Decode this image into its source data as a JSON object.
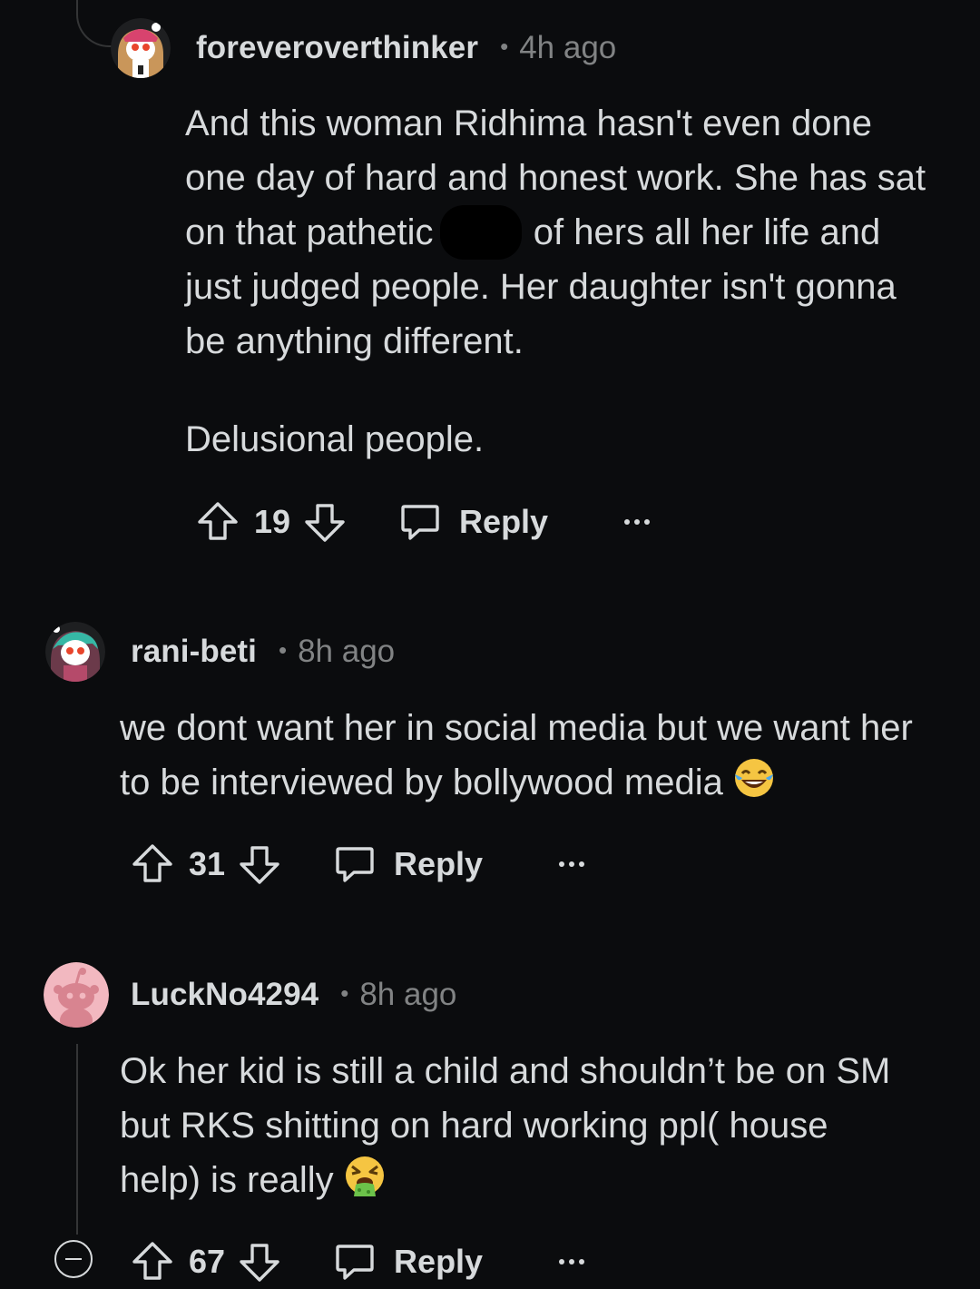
{
  "comments": [
    {
      "username": "foreveroverthinker",
      "separator": "•",
      "time": "4h ago",
      "body_paragraphs": [
        {
          "before": "And this woman Ridhima hasn't even done one day of hard and honest work. She has sat on that pathetic",
          "after": "of hers all her life and just judged people. Her daughter isn't gonna be anything different."
        },
        {
          "text": "Delusional people."
        }
      ],
      "score": "19",
      "reply_label": "Reply",
      "avatar_icon": "snoo-avatar-pink-hat"
    },
    {
      "username": "rani-beti",
      "separator": "•",
      "time": "8h ago",
      "body": "we dont want her in social media but we want her to be interviewed by bollywood media",
      "emoji": "face-with-tears-of-joy",
      "score": "31",
      "reply_label": "Reply",
      "avatar_icon": "snoo-avatar-teal-hair"
    },
    {
      "username": "LuckNo4294",
      "separator": "•",
      "time": "8h ago",
      "body": "Ok her kid is still a child and shouldn’t be on SM but RKS shitting on hard working ppl( house help) is really",
      "emoji": "face-vomiting",
      "score": "67",
      "reply_label": "Reply",
      "avatar_icon": "default-snoo-pink"
    }
  ],
  "colors": {
    "background": "#0b0c0e",
    "text": "#d7dadc",
    "meta": "#818384",
    "thread_line": "#343536",
    "avatar_pink_bg": "#f2b8c0"
  }
}
